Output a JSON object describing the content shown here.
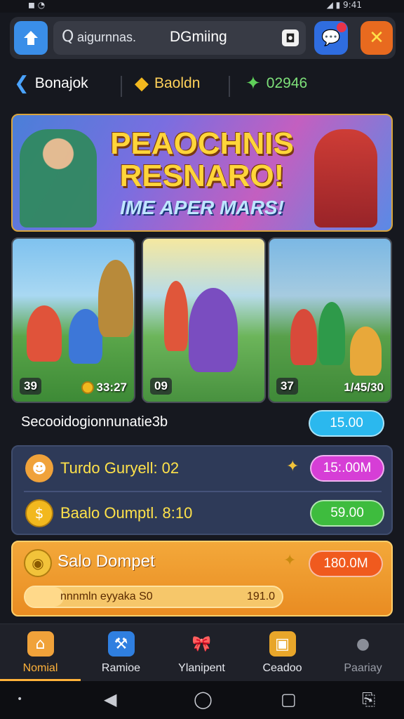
{
  "status_bar": {
    "left_text": "◼ ◔",
    "right_text": "◢ ▮ 9:41"
  },
  "top_bar": {
    "home_icon": "home-arrow-icon",
    "search_placeholder": "aigurnnas.",
    "brand": "DGmiing",
    "chat_icon": "chat-bubble-icon",
    "close_icon": "close-icon"
  },
  "currency": [
    {
      "icon": "arrow-icon",
      "label": "Bonajok",
      "color": "#ffffff"
    },
    {
      "icon": "gold-box-icon",
      "label": "Baoldn",
      "color": "#ffd15a"
    },
    {
      "icon": "gem-icon",
      "label": "02946",
      "color": "#7ee07a"
    }
  ],
  "banner": {
    "title_line1": "PEAOCHNIS",
    "title_line2": "RESNARO!",
    "subtitle": "IME APER MARS!"
  },
  "cards": [
    {
      "stat_left": "39",
      "stat_right": "33:27"
    },
    {
      "stat_left": "09",
      "stat_right": ""
    },
    {
      "stat_left": "37",
      "stat_right": "1/45/30"
    }
  ],
  "section": {
    "label": "Secooidogionnunatie3b",
    "button_label": "15.00",
    "button_color": "#2bb8ee"
  },
  "panel_rows": [
    {
      "icon": "avatar-icon",
      "label": "Turdo Guryell: 02",
      "button_label": "15:.00M",
      "button_color": "#d63ed6"
    },
    {
      "icon": "coin-icon",
      "label": "Baalo Oumptl. 8:10",
      "button_label": "59.00",
      "button_color": "#3ebc3e"
    }
  ],
  "gold_panel": {
    "title": "Salo Dompet",
    "button_label": "180.0M",
    "button_color": "#f05a1e",
    "progress_text": "nnnmln eyyaka S0",
    "progress_value": "191.0",
    "progress_fraction": 0.15
  },
  "bottom_nav": [
    {
      "icon": "home-icon",
      "label": "Nomial",
      "active": true
    },
    {
      "icon": "hammer-icon",
      "label": "Ramioe",
      "active": false
    },
    {
      "icon": "gift-bow-icon",
      "label": "Ylanipent",
      "active": false
    },
    {
      "icon": "treasure-chest-icon",
      "label": "Ceadoo",
      "active": false
    },
    {
      "icon": "profile-icon",
      "label": "Paariay",
      "active": false
    }
  ],
  "system_nav": {
    "back": "◀",
    "home": "◯",
    "recents": "▢",
    "assist": "⎘"
  }
}
